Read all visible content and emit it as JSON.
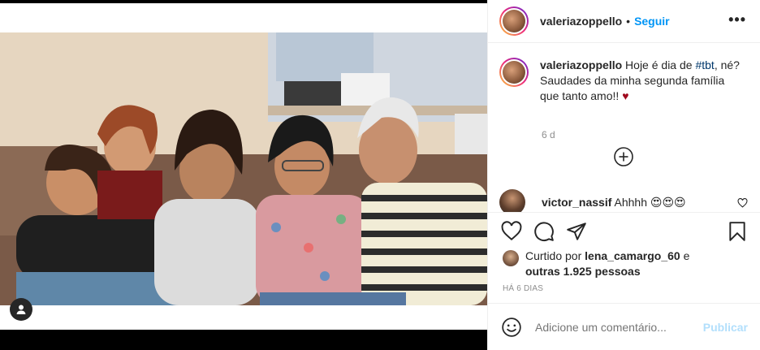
{
  "post": {
    "username": "valeriazoppello",
    "separator": "•",
    "follow_label": "Seguir",
    "more_label": "•••"
  },
  "caption": {
    "username": "valeriazoppello",
    "text_before_tag": " Hoje é dia de ",
    "hashtag": "#tbt",
    "text_after_tag": ", né? Saudades da minha segunda família que tanto amo!! ",
    "heart": "♥",
    "time": "6 d"
  },
  "comments": [
    {
      "username": "victor_nassif",
      "text": " Ahhhh 😍😍😍"
    }
  ],
  "likes": {
    "prefix": "Curtido por ",
    "user": "lena_camargo_60",
    "middle": " e ",
    "others": "outras 1.925 pessoas"
  },
  "date_label": "HÁ 6 DIAS",
  "add_comment": {
    "placeholder": "Adicione um comentário...",
    "publish_label": "Publicar"
  },
  "icons": {
    "like": "heart-icon",
    "comment": "comment-icon",
    "share": "share-icon",
    "save": "bookmark-icon",
    "emoji": "emoji-icon",
    "load_more": "plus-circle-icon",
    "user_tag": "user-tag-icon"
  },
  "colors": {
    "link_blue": "#0095f6",
    "publish_disabled": "#b2dffc",
    "hashtag": "#00376b",
    "heart_red": "#a00a1e",
    "muted": "#8e8e8e"
  }
}
